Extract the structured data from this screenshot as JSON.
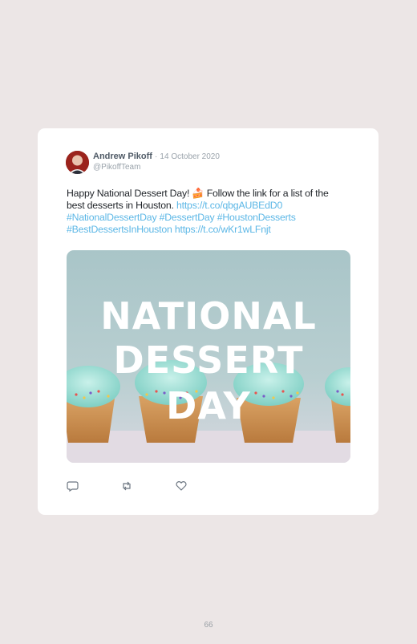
{
  "tweet": {
    "author_name": "Andrew Pikoff",
    "separator": "·",
    "date": "14 October 2020",
    "handle": "@PikoffTeam",
    "text_before": "Happy National Dessert Day! 🍰 Follow the link for a list of the best desserts in Houston. ",
    "link_1": "https://t.co/qbgAUBEdD0",
    "hashtags": [
      "#NationalDessertDay",
      "#DessertDay",
      "#HoustonDesserts",
      "#BestDessertsInHouston"
    ],
    "link_2": "https://t.co/wKr1wLFnjt",
    "image_text": [
      "NATIONAL",
      "DESSERT",
      "DAY"
    ]
  },
  "actions": {
    "reply_icon": "reply-icon",
    "retweet_icon": "retweet-icon",
    "like_icon": "heart-icon"
  },
  "page": {
    "number": "66"
  }
}
